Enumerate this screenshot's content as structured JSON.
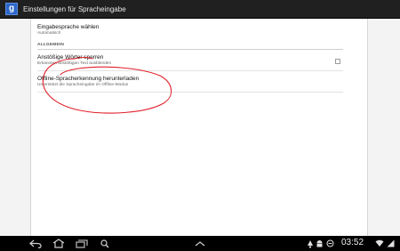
{
  "actionbar": {
    "app_icon_letter": "g",
    "title": "Einstellungen für Spracheingabe"
  },
  "prefs": {
    "language": {
      "title": "Eingabesprache wählen",
      "summary": "Automatisch"
    },
    "category": "ALLGEMEIN",
    "offensive": {
      "title": "Anstößige Wörter sperren",
      "summary": "Erkannten anstößigen Text ausblenden",
      "checked": false
    },
    "offline": {
      "title": "Offline-Spracherkennung herunterladen",
      "summary": "Unterstützt die Spracheingabe im Offline-Modus"
    }
  },
  "annotation": {
    "color": "#e0202a"
  },
  "navbar": {
    "icons": [
      "back-icon",
      "home-icon",
      "recent-apps-icon",
      "search-icon",
      "up-arrow-icon",
      "notification-icon",
      "android-icon",
      "sync-icon",
      "wifi-icon",
      "signal-icon"
    ],
    "clock": "03:52"
  }
}
